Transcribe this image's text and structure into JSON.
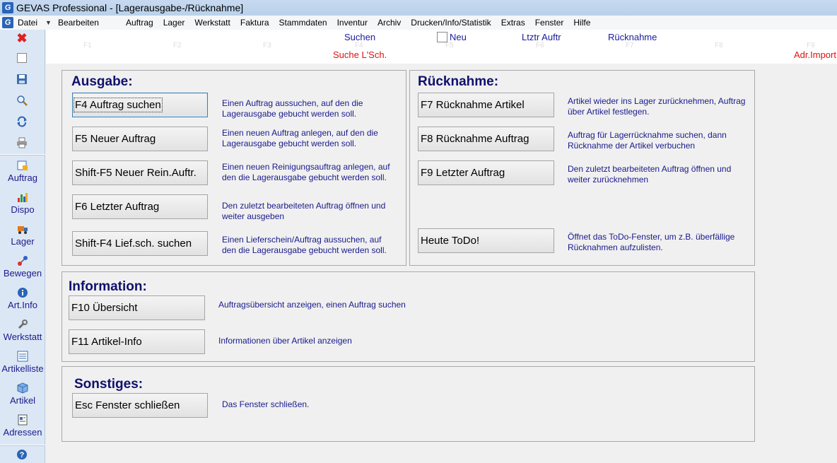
{
  "window": {
    "title": "GEVAS Professional - [Lagerausgabe-/Rücknahme]",
    "app_icon": "gevas-logo-icon"
  },
  "menu": {
    "items": [
      "Datei",
      "Bearbeiten",
      "Auftrag",
      "Lager",
      "Werkstatt",
      "Faktura",
      "Stammdaten",
      "Inventur",
      "Archiv",
      "Drucken/Info/Statistik",
      "Extras",
      "Fenster",
      "Hilfe"
    ]
  },
  "toolbar": {
    "fkeys": [
      "F1",
      "F2",
      "F3",
      "F4",
      "F5",
      "F6",
      "F7",
      "F8",
      "F9"
    ],
    "suchen": "Suchen",
    "neu": "Neu",
    "letzter_auftrag": "Ltztr Auftr",
    "ruecknahme": "Rücknahme",
    "suche_lsch": "Suche L'Sch.",
    "adr_import": "Adr.Import"
  },
  "sidebar": {
    "tools": [
      "close-icon",
      "new-document-icon",
      "save-icon",
      "search-icon",
      "refresh-icon",
      "print-icon"
    ],
    "nav": [
      "Auftrag",
      "Dispo",
      "Lager",
      "Bewegen",
      "Art.Info",
      "Werkstatt",
      "Artikelliste",
      "Artikel",
      "Adressen"
    ],
    "help_icon": "help-icon"
  },
  "ausgabe": {
    "title": "Ausgabe:",
    "actions": [
      {
        "label": "F4 Auftrag suchen",
        "desc1": "Einen Auftrag aussuchen, auf den die",
        "desc2": "Lagerausgabe gebucht  werden soll."
      },
      {
        "label": "F5 Neuer Auftrag",
        "desc1": "Einen neuen Auftrag anlegen, auf den die",
        "desc2": "Lagerausgabe gebucht  werden soll."
      },
      {
        "label": "Shift-F5 Neuer Rein.Auftr.",
        "desc1": "Einen neuen Reinigungsauftrag anlegen, auf",
        "desc2": "den die Lagerausgabe gebucht  werden soll."
      },
      {
        "label": "F6 Letzter Auftrag",
        "desc1": "Den zuletzt bearbeiteten Auftrag öffnen und",
        "desc2": "weiter ausgeben"
      },
      {
        "label": "Shift-F4 Lief.sch. suchen",
        "desc1": "Einen Lieferschein/Auftrag aussuchen, auf",
        "desc2": "den die Lagerausgabe gebucht  werden soll."
      }
    ]
  },
  "ruecknahme": {
    "title": "Rücknahme:",
    "actions": [
      {
        "label": "F7 Rücknahme Artikel",
        "desc1": "Artikel wieder ins Lager zurücknehmen, Auftrag",
        "desc2": "über Artikel festlegen."
      },
      {
        "label": "F8 Rücknahme Auftrag",
        "desc1": "Auftrag für Lagerrücknahme suchen, dann",
        "desc2": "Rücknahme der Artikel verbuchen"
      },
      {
        "label": "F9 Letzter Auftrag",
        "desc1": "Den zuletzt bearbeiteten Auftrag öffnen und",
        "desc2": "weiter zurücknehmen"
      },
      {
        "label": "Heute ToDo!",
        "desc1": "Öffnet das ToDo-Fenster, um z.B. überfällige",
        "desc2": "Rücknahmen aufzulisten."
      }
    ]
  },
  "information": {
    "title": "Information:",
    "actions": [
      {
        "label": "F10 Übersicht",
        "desc1": "Auftragsübersicht anzeigen, einen Auftrag suchen"
      },
      {
        "label": "F11 Artikel-Info",
        "desc1": "Informationen über Artikel anzeigen"
      }
    ]
  },
  "sonstiges": {
    "title": "Sonstiges:",
    "actions": [
      {
        "label": "Esc Fenster schließen",
        "desc1": "Das Fenster schließen."
      }
    ]
  }
}
